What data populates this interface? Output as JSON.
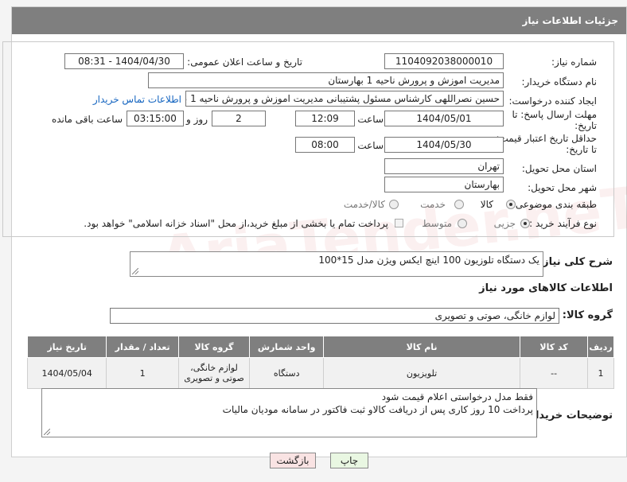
{
  "header": {
    "title": "جزئیات اطلاعات نیاز"
  },
  "fields": {
    "need_number_label": "شماره نیاز:",
    "need_number": "1104092038000010",
    "announce_label": "تاریخ و ساعت اعلان عمومی:",
    "announce_value": "1404/04/30 - 08:31",
    "buyer_org_label": "نام دستگاه خریدار:",
    "buyer_org": "مدیریت اموزش و پرورش ناحیه 1 بهارستان",
    "requester_label": "ایجاد کننده درخواست:",
    "requester": "حسین نصراللهی کارشناس مسئول پشتیبانی مدیریت اموزش و پرورش ناحیه 1 بهارستان",
    "contact_link": "اطلاعات تماس خریدار",
    "deadline_label_1": "مهلت ارسال پاسخ: تا",
    "deadline_label_2": "تاریخ:",
    "deadline_date": "1404/05/01",
    "time_label": "ساعت",
    "deadline_time": "12:09",
    "days_value": "2",
    "days_label": "روز و",
    "remaining_time": "03:15:00",
    "remaining_label": "ساعت باقی مانده",
    "validity_label_1": "حداقل تاریخ اعتبار قیمت:",
    "validity_label_2": "تا تاریخ:",
    "validity_date": "1404/05/30",
    "validity_time": "08:00",
    "province_label": "استان محل تحویل:",
    "province": "تهران",
    "city_label": "شهر محل تحویل:",
    "city": "بهارستان",
    "category_label": "طبقه بندی موضوعی:",
    "category_options": [
      "کالا",
      "خدمت",
      "کالا/خدمت"
    ],
    "category_selected": "کالا",
    "process_label": "نوع فرآیند خرید :",
    "process_options": [
      "جزیی",
      "متوسط"
    ],
    "process_selected": "جزیی",
    "payment_note": "پرداخت تمام یا بخشی از مبلغ خرید،از محل \"اسناد خزانه اسلامی\" خواهد بود."
  },
  "description": {
    "label": "شرح کلی نیاز:",
    "text": "یک دستگاه تلوزیون 100 اینچ ایکس ویژن مدل 15*100"
  },
  "goods_section_title": "اطلاعات کالاهای مورد نیاز",
  "goods_group": {
    "label": "گروه کالا:",
    "value": "لوازم خانگی، صوتی و تصویری"
  },
  "table": {
    "headers": [
      "ردیف",
      "کد کالا",
      "نام کالا",
      "واحد شمارش",
      "گروه کالا",
      "تعداد / مقدار",
      "تاریخ نیاز"
    ],
    "rows": [
      [
        "1",
        "--",
        "تلویزیون",
        "دستگاه",
        "لوازم خانگی، صوتی و تصویری",
        "1",
        "1404/05/04"
      ]
    ]
  },
  "buyer_notes": {
    "label": "توضیحات خریدار:",
    "line1": "فقط مدل درخواستی اعلام قیمت شود",
    "line2": "پرداخت 10 روز کاری پس از دریافت کالاو ثبت فاکتور در سامانه مودیان مالیات"
  },
  "buttons": {
    "print": "چاپ",
    "back": "بازگشت"
  },
  "watermark": "AriaTender.neT",
  "colors": {
    "header_bg": "#7f7f7f",
    "link": "#1565c0",
    "print_btn": "#e9f7e2",
    "back_btn": "#f9e3e3"
  }
}
